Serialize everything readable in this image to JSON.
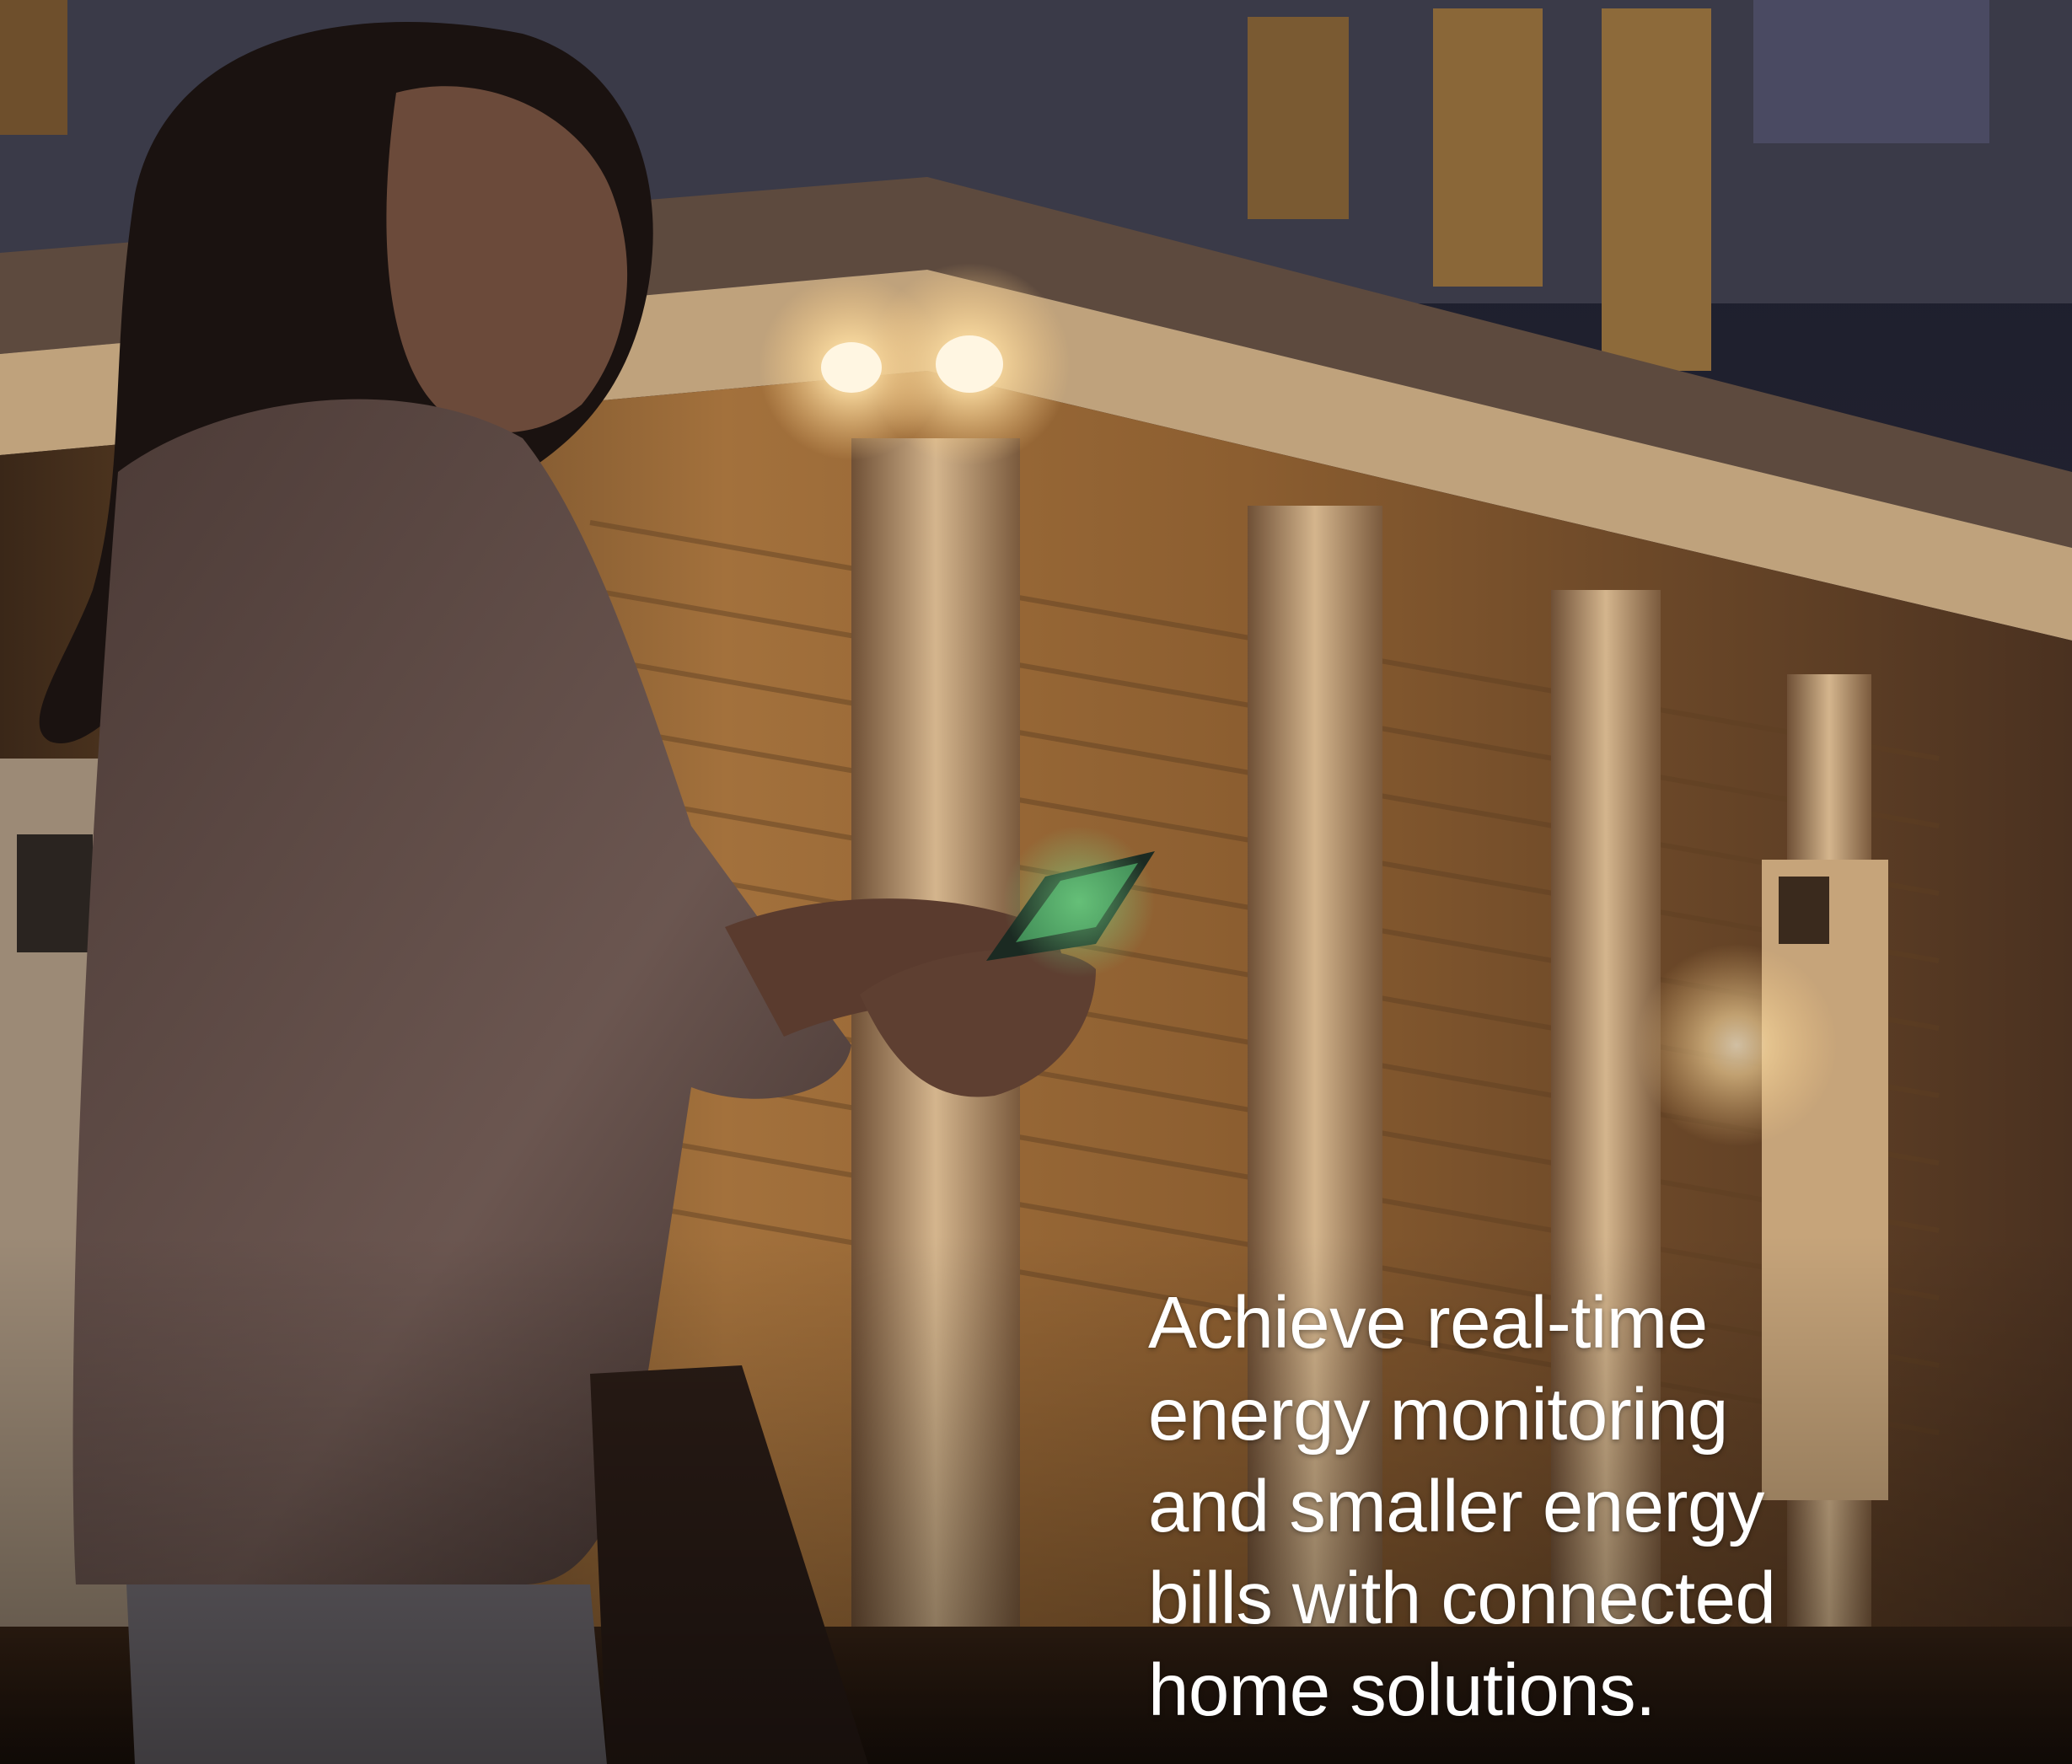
{
  "caption": {
    "text": "Achieve real-time\nenergy monitoring\nand smaller energy\nbills with connected\nhome solutions."
  },
  "colors": {
    "caption_text": "#ffffff",
    "warm_light": "#f3c784",
    "night_sky": "#2e3144"
  }
}
